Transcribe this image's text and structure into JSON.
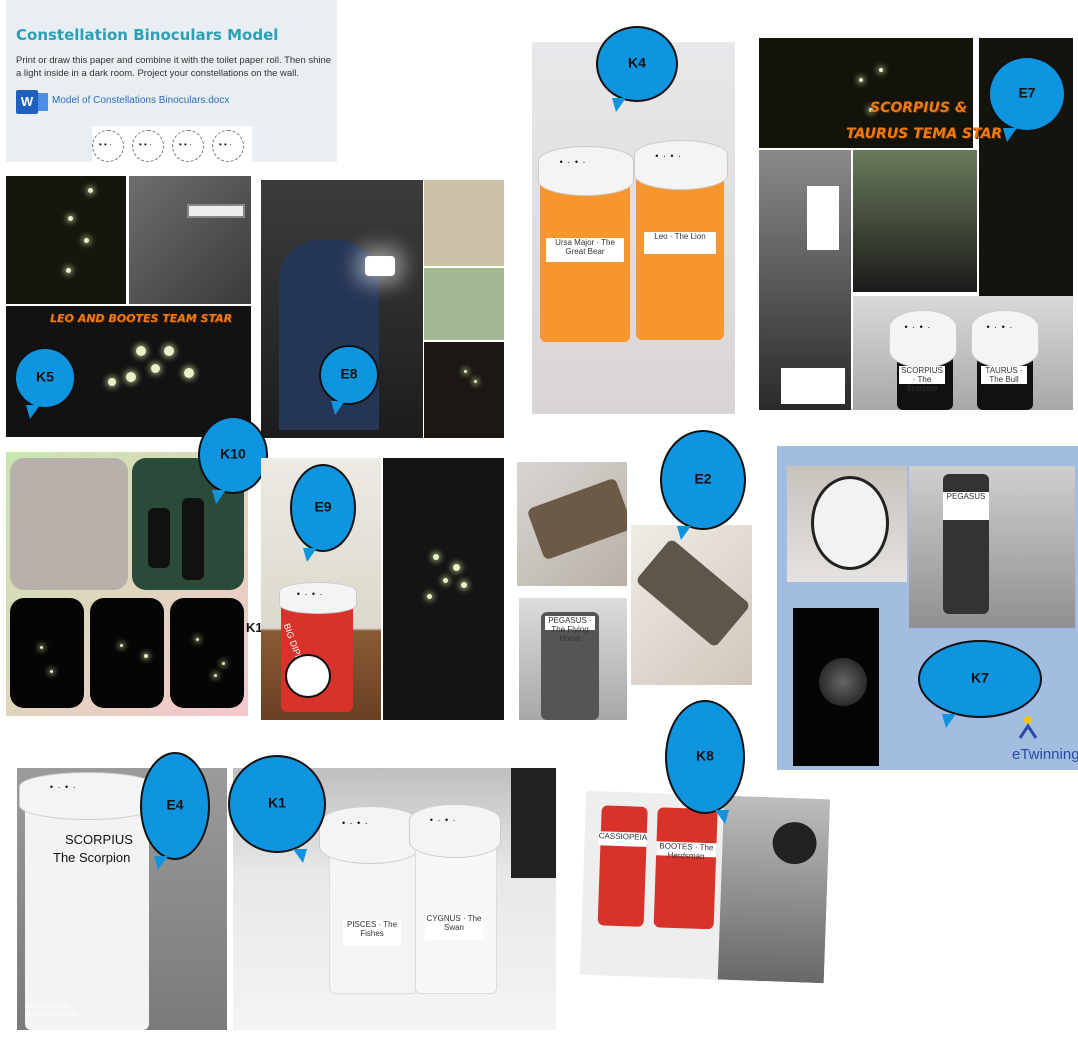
{
  "header": {
    "title": "Constellation Binoculars Model",
    "description": "Print or draw this paper and combine it with the toilet paper roll. Then shine a light inside in a dark room. Project your constellations on the wall.",
    "word_icon": "W",
    "doc_link": "Model of Constellations Binoculars.docx"
  },
  "bubbles": {
    "k4": "K4",
    "e7": "E7",
    "k5": "K5",
    "e8": "E8",
    "k10": "K10",
    "e9": "E9",
    "e2": "E2",
    "k7": "K7",
    "k8": "K8",
    "e4": "E4",
    "k1": "K1",
    "k1_side": "K1"
  },
  "captions": {
    "k5_team": "LEO AND BOOTES TEAM STAR",
    "e7_team_line1": "SCORPIUS &",
    "e7_team_line2": "TAURUS TEMA STAR",
    "etwinning": "eTwinning"
  },
  "labels": {
    "k4_left": "Ursa Major · The Great Bear",
    "k4_right": "Leo · The Lion",
    "e9_tube": "BIG DIPPER",
    "e2_tube": "PEGASUS · The Flying Horse",
    "k7_tube": "PEGASUS",
    "e4_line1": "SCORPIUS",
    "e4_line2": "The Scorpion",
    "e4_camera_line1": "REDMI NOTE 8",
    "e4_camera_line2": "AI QUAD CAMERA",
    "k1_left": "PISCES · The Fishes",
    "k1_right": "CYGNUS · The Swan",
    "k8_left": "CASSIOPEIA",
    "k8_right": "BOOTES · The Herdsman",
    "e7_left": "SCORPIUS · The Scorpion",
    "e7_right": "TAURUS · The Bull"
  },
  "colors": {
    "bubble": "#0f94e0",
    "title": "#2aa0b8",
    "team_text": "#f07a12",
    "orange_tube": "#f7962f",
    "red_tube": "#d8332b"
  },
  "icons": [
    "word-doc-icon",
    "etwinning-logo-icon"
  ]
}
